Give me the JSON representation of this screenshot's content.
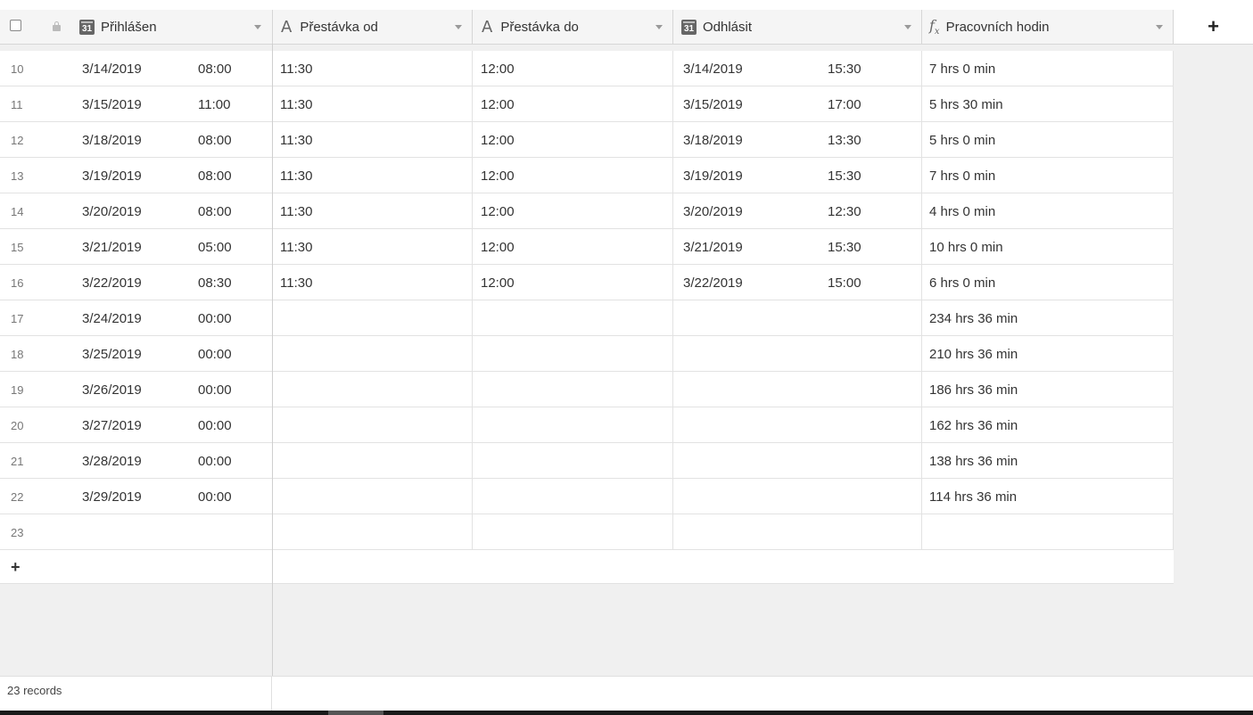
{
  "header": {
    "add_field_label": "+",
    "columns": [
      {
        "label": "Přihlášen",
        "icon": "calendar-icon",
        "icon_text": "31"
      },
      {
        "label": "Přestávka od",
        "icon": "text-field-icon",
        "icon_text": "A"
      },
      {
        "label": "Přestávka do",
        "icon": "text-field-icon",
        "icon_text": "A"
      },
      {
        "label": "Odhlásit",
        "icon": "calendar-icon",
        "icon_text": "31"
      },
      {
        "label": "Pracovních hodin",
        "icon": "formula-icon",
        "icon_text": "f"
      }
    ]
  },
  "rows": [
    {
      "num": "10",
      "login_date": "3/14/2019",
      "login_time": "08:00",
      "break_from": "11:30",
      "break_to": "12:00",
      "logout_date": "3/14/2019",
      "logout_time": "15:30",
      "hours": "7 hrs 0 min"
    },
    {
      "num": "11",
      "login_date": "3/15/2019",
      "login_time": "11:00",
      "break_from": "11:30",
      "break_to": "12:00",
      "logout_date": "3/15/2019",
      "logout_time": "17:00",
      "hours": "5 hrs 30 min"
    },
    {
      "num": "12",
      "login_date": "3/18/2019",
      "login_time": "08:00",
      "break_from": "11:30",
      "break_to": "12:00",
      "logout_date": "3/18/2019",
      "logout_time": "13:30",
      "hours": "5 hrs 0 min"
    },
    {
      "num": "13",
      "login_date": "3/19/2019",
      "login_time": "08:00",
      "break_from": "11:30",
      "break_to": "12:00",
      "logout_date": "3/19/2019",
      "logout_time": "15:30",
      "hours": "7 hrs 0 min"
    },
    {
      "num": "14",
      "login_date": "3/20/2019",
      "login_time": "08:00",
      "break_from": "11:30",
      "break_to": "12:00",
      "logout_date": "3/20/2019",
      "logout_time": "12:30",
      "hours": "4 hrs 0 min"
    },
    {
      "num": "15",
      "login_date": "3/21/2019",
      "login_time": "05:00",
      "break_from": "11:30",
      "break_to": "12:00",
      "logout_date": "3/21/2019",
      "logout_time": "15:30",
      "hours": "10 hrs 0 min"
    },
    {
      "num": "16",
      "login_date": "3/22/2019",
      "login_time": "08:30",
      "break_from": "11:30",
      "break_to": "12:00",
      "logout_date": "3/22/2019",
      "logout_time": "15:00",
      "hours": "6 hrs 0 min"
    },
    {
      "num": "17",
      "login_date": "3/24/2019",
      "login_time": "00:00",
      "break_from": "",
      "break_to": "",
      "logout_date": "",
      "logout_time": "",
      "hours": "234 hrs 36 min"
    },
    {
      "num": "18",
      "login_date": "3/25/2019",
      "login_time": "00:00",
      "break_from": "",
      "break_to": "",
      "logout_date": "",
      "logout_time": "",
      "hours": "210 hrs 36 min"
    },
    {
      "num": "19",
      "login_date": "3/26/2019",
      "login_time": "00:00",
      "break_from": "",
      "break_to": "",
      "logout_date": "",
      "logout_time": "",
      "hours": "186 hrs 36 min"
    },
    {
      "num": "20",
      "login_date": "3/27/2019",
      "login_time": "00:00",
      "break_from": "",
      "break_to": "",
      "logout_date": "",
      "logout_time": "",
      "hours": "162 hrs 36 min"
    },
    {
      "num": "21",
      "login_date": "3/28/2019",
      "login_time": "00:00",
      "break_from": "",
      "break_to": "",
      "logout_date": "",
      "logout_time": "",
      "hours": "138 hrs 36 min"
    },
    {
      "num": "22",
      "login_date": "3/29/2019",
      "login_time": "00:00",
      "break_from": "",
      "break_to": "",
      "logout_date": "",
      "logout_time": "",
      "hours": "114 hrs 36 min"
    },
    {
      "num": "23",
      "login_date": "",
      "login_time": "",
      "break_from": "",
      "break_to": "",
      "logout_date": "",
      "logout_time": "",
      "hours": ""
    }
  ],
  "add_row_label": "+",
  "footer": {
    "records": "23 records"
  }
}
